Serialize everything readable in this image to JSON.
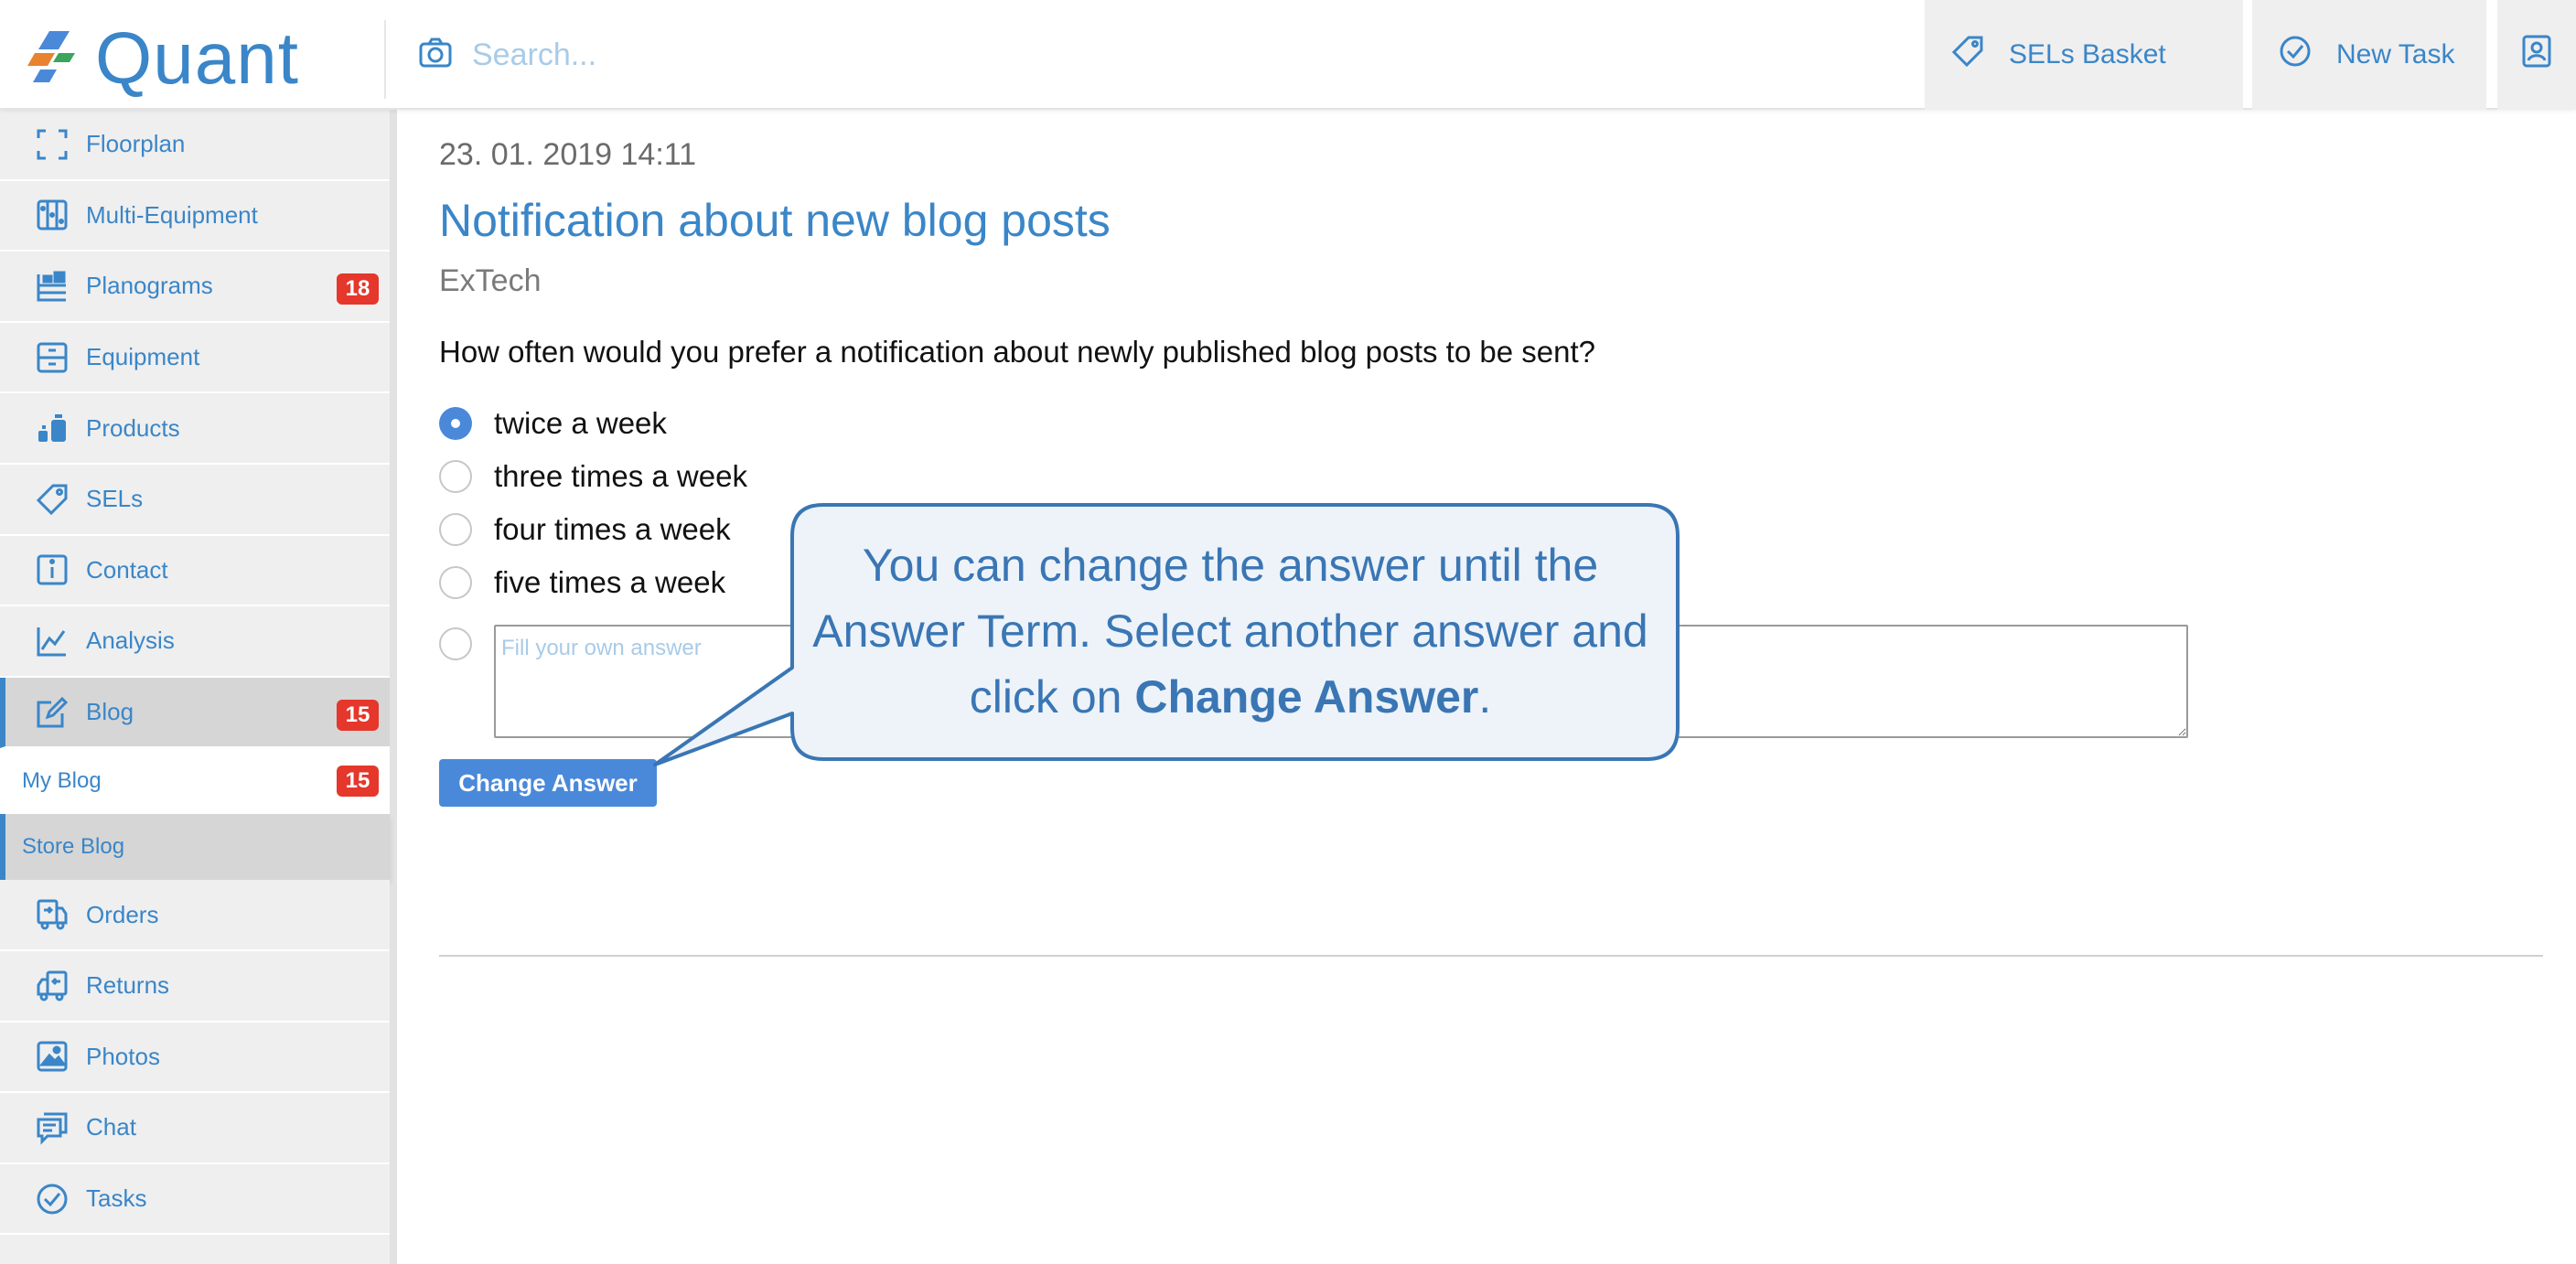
{
  "app": {
    "logo_text": "Quant"
  },
  "search": {
    "placeholder": "Search..."
  },
  "topbar": {
    "sels_basket_label": "SELs Basket",
    "new_task_label": "New Task"
  },
  "sidebar": {
    "items": [
      {
        "label": "Floorplan",
        "icon": "floorplan-icon"
      },
      {
        "label": "Multi-Equipment",
        "icon": "multi-equipment-icon"
      },
      {
        "label": "Planograms",
        "icon": "planograms-icon",
        "badge": "18"
      },
      {
        "label": "Equipment",
        "icon": "equipment-icon"
      },
      {
        "label": "Products",
        "icon": "products-icon"
      },
      {
        "label": "SELs",
        "icon": "tag-icon"
      },
      {
        "label": "Contact",
        "icon": "info-icon"
      },
      {
        "label": "Analysis",
        "icon": "chart-icon"
      },
      {
        "label": "Blog",
        "icon": "edit-icon",
        "badge": "15"
      }
    ],
    "subitems": [
      {
        "label": "My Blog",
        "badge": "15"
      },
      {
        "label": "Store Blog"
      }
    ],
    "items_after": [
      {
        "label": "Orders",
        "icon": "truck-icon"
      },
      {
        "label": "Returns",
        "icon": "return-truck-icon"
      },
      {
        "label": "Photos",
        "icon": "image-icon"
      },
      {
        "label": "Chat",
        "icon": "chat-icon"
      },
      {
        "label": "Tasks",
        "icon": "check-circle-icon"
      }
    ]
  },
  "post": {
    "date": "23. 01. 2019 14:11",
    "title": "Notification about new blog posts",
    "author": "ExTech",
    "question": "How often would you prefer a notification about newly published blog posts to be sent?",
    "options": [
      {
        "label": "twice a week",
        "selected": true
      },
      {
        "label": "three times a week",
        "selected": false
      },
      {
        "label": "four times a week",
        "selected": false
      },
      {
        "label": "five times a week",
        "selected": false
      }
    ],
    "own_answer_placeholder": "Fill your own answer",
    "change_button_label": "Change Answer"
  },
  "callout": {
    "text_before": "You can change the answer until the Answer Term. Select another answer and click on ",
    "text_bold": "Change Answer",
    "text_after": "."
  },
  "colors": {
    "accent": "#3a86c8",
    "badge": "#e5372b",
    "button": "#4a89d9",
    "callout_border": "#3a76b4",
    "callout_fill": "#edf3f9"
  }
}
